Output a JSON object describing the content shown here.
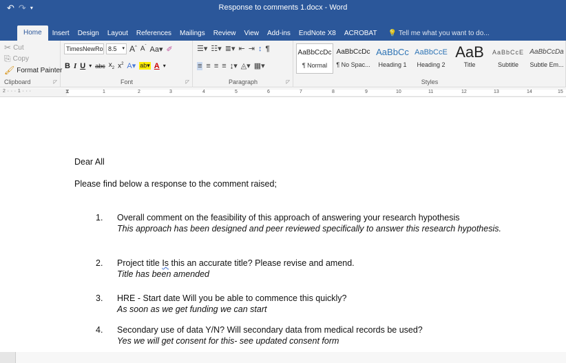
{
  "window": {
    "title": "Response to comments 1.docx - Word",
    "qat": {
      "undo": "↶",
      "redo": "↷",
      "more": "▾"
    }
  },
  "tabs": [
    "Home",
    "Insert",
    "Design",
    "Layout",
    "References",
    "Mailings",
    "Review",
    "View",
    "Add-ins",
    "EndNote X8",
    "ACROBAT"
  ],
  "tell_me": "Tell me what you want to do...",
  "clipboard": {
    "cut": "Cut",
    "copy": "Copy",
    "format_painter": "Format Painter",
    "label": "Clipboard"
  },
  "font": {
    "name": "TimesNewRo",
    "size": "8.5",
    "label": "Font"
  },
  "paragraph": {
    "label": "Paragraph"
  },
  "styles": {
    "label": "Styles",
    "items": [
      {
        "sample": "AaBbCcDc",
        "name": "¶ Normal"
      },
      {
        "sample": "AaBbCcDc",
        "name": "¶ No Spac..."
      },
      {
        "sample": "AaBbCc",
        "name": "Heading 1"
      },
      {
        "sample": "AaBbCcE",
        "name": "Heading 2"
      },
      {
        "sample": "AaB",
        "name": "Title"
      },
      {
        "sample": "AaBbCcE",
        "name": "Subtitle"
      },
      {
        "sample": "AaBbCcDa",
        "name": "Subtle Em..."
      }
    ]
  },
  "ruler": {
    "left_marks": "2 · · · 1 · · ·",
    "numbers": [
      "1",
      "2",
      "3",
      "4",
      "5",
      "6",
      "7",
      "8",
      "9",
      "10",
      "11",
      "12",
      "13",
      "14",
      "15"
    ]
  },
  "document": {
    "greeting": "Dear All",
    "intro": "Please find below a response to the comment raised;",
    "items": [
      {
        "num": "1.",
        "question": "Overall comment on the feasibility of this approach of answering your research hypothesis",
        "answer": "This approach has been designed and peer reviewed specifically to answer this research hypothesis."
      },
      {
        "num": "2.",
        "question_pre": "Project title ",
        "question_flag": "Is",
        "question_post": " this an accurate title? Please revise and amend.",
        "answer": "Title has been amended"
      },
      {
        "num": "3.",
        "question": "HRE - Start date Will you be able to commence this quickly?",
        "answer": "As soon as we get funding we can start"
      },
      {
        "num": "4.",
        "question": "Secondary use of data Y/N? Will secondary data from medical records be used?",
        "answer": "Yes we will get consent for this- see updated consent form"
      }
    ]
  }
}
